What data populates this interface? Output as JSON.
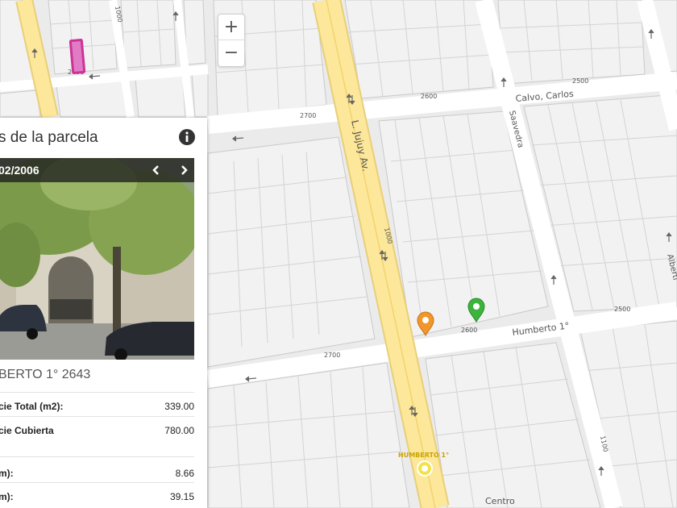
{
  "map": {
    "zoom_in_label": "+",
    "zoom_out_label": "−",
    "street_labels": {
      "av_jujuy": "L. Jujuy Av.",
      "calvo_carlos": "Calvo, Carlos",
      "saavedra": "Saavedra",
      "humberto_1": "Humberto 1°",
      "humberto_1_caps": "HUMBERTO 1°",
      "alberti": "Alberti",
      "centro": "Centro"
    },
    "house_numbers": {
      "n1000_top": "1000",
      "n2600_top": "2600",
      "n2700_a": "2700",
      "n2600_b": "2600",
      "n2500_a": "2500",
      "n1000_mid": "1000",
      "n2600_c": "2600",
      "n2500_b": "2500",
      "n2700_b": "2700",
      "n1100": "1100"
    },
    "marker_colors": {
      "selected_parcel": "#cc3399",
      "orange_pin": "#f0962a",
      "green_pin": "#3cb43c",
      "yellow_poi": "#f2e34a"
    }
  },
  "panel": {
    "title": "s de la parcela",
    "photo_date": "02/2006",
    "address": "BERTO 1° 2643",
    "attributes": [
      {
        "label": "cie Total (m2):",
        "value": "339.00"
      },
      {
        "label": "cie Cubierta",
        "value": "780.00"
      },
      {
        "label": "m):",
        "value": "8.66"
      },
      {
        "label": "m):",
        "value": "39.15"
      }
    ]
  }
}
